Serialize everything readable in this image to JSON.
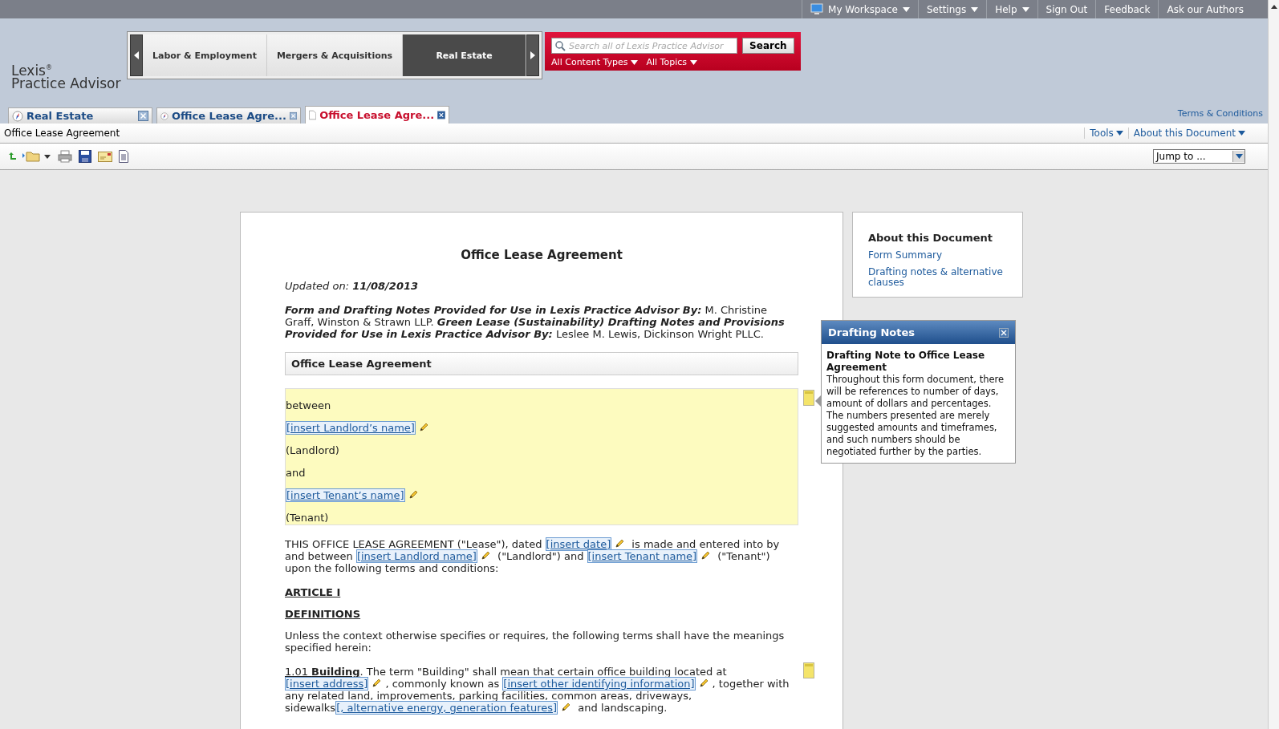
{
  "top_menu": [
    {
      "label": "My Workspace",
      "kind": "workspace",
      "dropdown": true
    },
    {
      "label": "Settings",
      "kind": "plain",
      "dropdown": true
    },
    {
      "label": "Help",
      "kind": "plain",
      "dropdown": true
    },
    {
      "label": "Sign Out",
      "kind": "plain",
      "dropdown": false
    },
    {
      "label": "Feedback",
      "kind": "plain",
      "dropdown": false
    },
    {
      "label": "Ask our Authors",
      "kind": "plain",
      "dropdown": false
    }
  ],
  "logo": {
    "brand": "Lexis",
    "mark": "®",
    "product": "Practice Advisor"
  },
  "practice_areas": [
    {
      "label": "Labor & Employment",
      "selected": false
    },
    {
      "label": "Mergers & Acquisitions",
      "selected": false
    },
    {
      "label": "Real Estate",
      "selected": true
    }
  ],
  "search": {
    "placeholder": "Search all of Lexis Practice Advisor",
    "button": "Search",
    "filters": [
      "All Content Types",
      "All Topics"
    ]
  },
  "terms_link": "Terms & Conditions",
  "tabs": [
    {
      "label": "Real Estate",
      "kind": "compass",
      "selected": false
    },
    {
      "label": "Office Lease Agre...",
      "kind": "compass",
      "selected": false
    },
    {
      "label": "Office Lease Agre...",
      "kind": "document",
      "selected": true
    }
  ],
  "doc_bar": {
    "title": "Office Lease Agreement",
    "menus": [
      "Tools",
      "About this Document"
    ]
  },
  "toolbar": {
    "jump_to": "Jump to ..."
  },
  "document": {
    "title": "Office Lease Agreement",
    "blocks": [
      {
        "kind": "para",
        "segments": [
          {
            "kind": "italic",
            "text": "Updated on: "
          },
          {
            "kind": "bold-italic",
            "text": "11/08/2013"
          }
        ]
      },
      {
        "kind": "para",
        "segments": [
          {
            "kind": "bold-italic",
            "text": "Form and Drafting Notes Provided for Use in Lexis Practice Advisor By:"
          },
          {
            "kind": "text",
            "text": " M. Christine Graff, Winston & Strawn LLP. "
          },
          {
            "kind": "bold-italic",
            "text": "Green Lease (Sustainability) Drafting Notes and Provisions Provided for Use in Lexis Practice Advisor By:"
          },
          {
            "kind": "text",
            "text": " Leslee M. Lewis, Dickinson Wright PLLC."
          }
        ]
      },
      {
        "kind": "section",
        "text": "Office Lease Agreement"
      },
      {
        "kind": "highlight",
        "note": true,
        "lines": [
          [
            {
              "kind": "text",
              "text": "between"
            }
          ],
          [
            {
              "kind": "field",
              "text": "[insert Landlord’s name]"
            }
          ],
          [
            {
              "kind": "text",
              "text": "(Landlord)"
            }
          ],
          [
            {
              "kind": "text",
              "text": "and"
            }
          ],
          [
            {
              "kind": "field",
              "text": "[insert Tenant’s name]"
            }
          ],
          [
            {
              "kind": "text",
              "text": "(Tenant)"
            }
          ]
        ]
      },
      {
        "kind": "para",
        "segments": [
          {
            "kind": "text",
            "text": "THIS OFFICE LEASE AGREEMENT (\"Lease\"), dated "
          },
          {
            "kind": "field",
            "text": "[insert date]"
          },
          {
            "kind": "text",
            "text": " is made and entered into by and between "
          },
          {
            "kind": "field",
            "text": "[insert Landlord name]"
          },
          {
            "kind": "text",
            "text": " (\"Landlord\") and "
          },
          {
            "kind": "field",
            "text": "[insert Tenant name]"
          },
          {
            "kind": "text",
            "text": " (\"Tenant\") upon the following terms and conditions:"
          }
        ]
      },
      {
        "kind": "heading",
        "text": "ARTICLE I"
      },
      {
        "kind": "heading",
        "text": "DEFINITIONS"
      },
      {
        "kind": "para",
        "segments": [
          {
            "kind": "text",
            "text": "Unless the context otherwise specifies or requires, the following terms shall have the meanings specified herein:"
          }
        ]
      },
      {
        "kind": "para",
        "note": true,
        "segments": [
          {
            "kind": "term",
            "text": "1.01 **Building**"
          },
          {
            "kind": "text",
            "text": ". The term \"Building\" shall mean that certain office building located at "
          },
          {
            "kind": "field",
            "text": "[insert address]"
          },
          {
            "kind": "text",
            "text": ", commonly known as "
          },
          {
            "kind": "field",
            "text": "[insert other identifying information]"
          },
          {
            "kind": "text",
            "text": ", together with any related land, improvements, parking facilities, common areas, driveways, sidewalks"
          },
          {
            "kind": "field",
            "text": "[, alternative energy, generation features]"
          },
          {
            "kind": "text",
            "text": " and landscaping."
          }
        ]
      }
    ]
  },
  "about": {
    "title": "About this Document",
    "links": [
      "Form Summary",
      "Drafting notes & alternative clauses"
    ]
  },
  "drafting_notes": {
    "title": "Drafting Notes",
    "heading": "Drafting Note to Office Lease Agreement",
    "body": "Throughout this form document, there will be references to number of days, amount of dollars and percentages. The numbers presented are merely suggested amounts and timeframes, and such numbers should be negotiated further by the parties."
  }
}
